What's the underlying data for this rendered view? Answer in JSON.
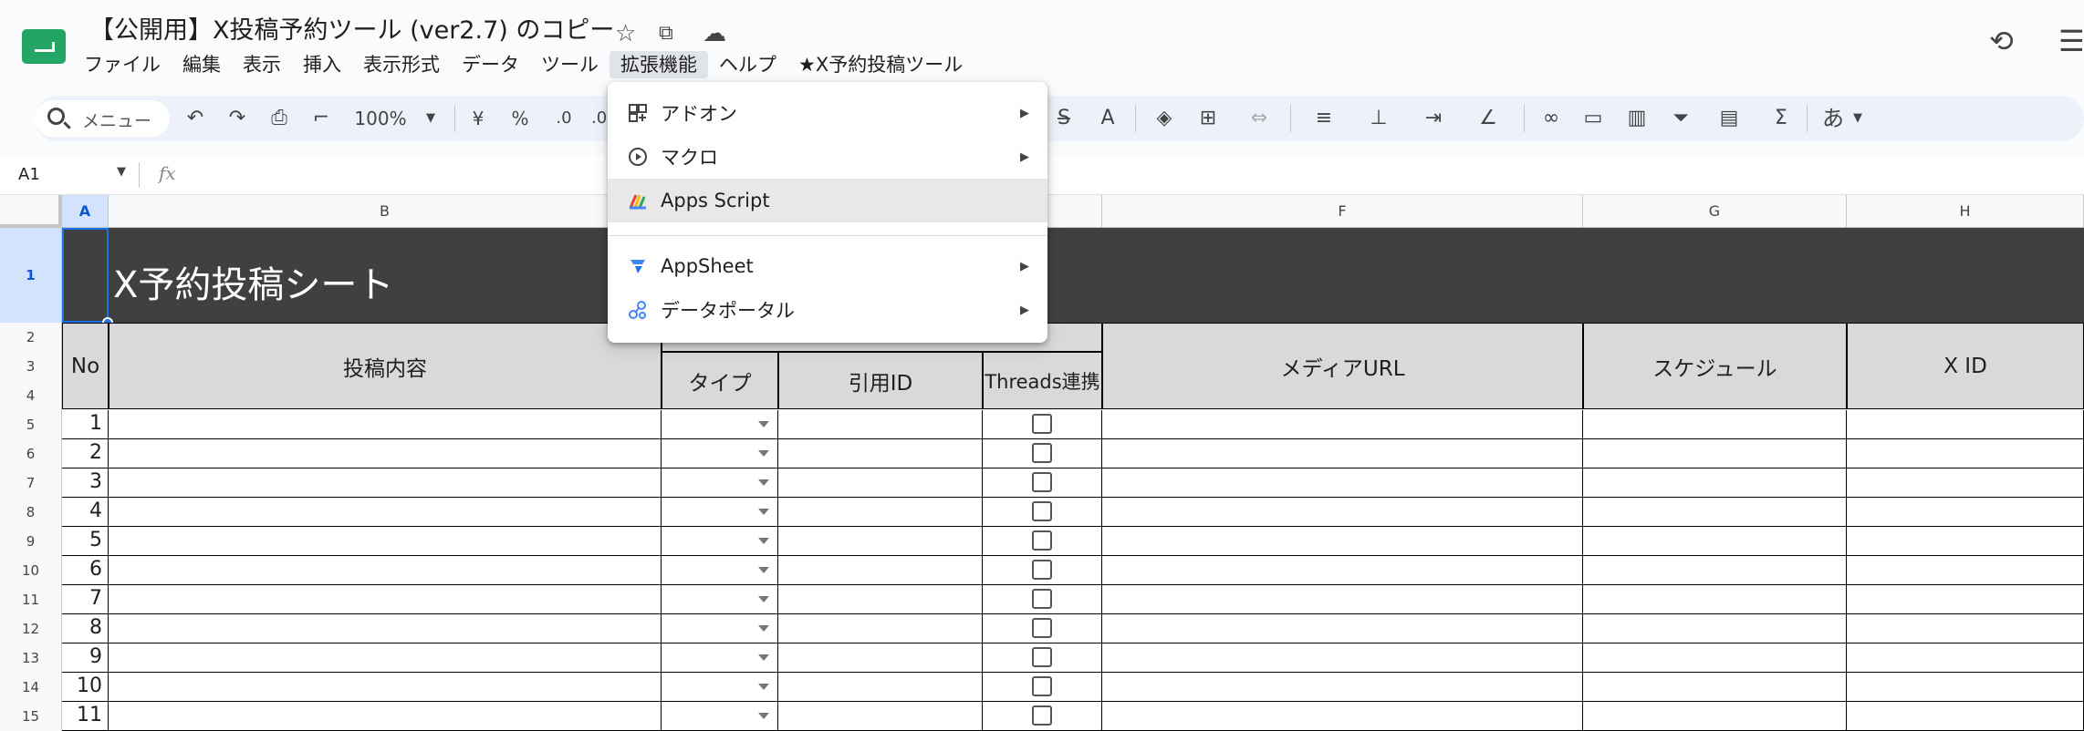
{
  "doc": {
    "title": "【公開用】X投稿予約ツール (ver2.7) のコピー"
  },
  "menus": [
    "ファイル",
    "編集",
    "表示",
    "挿入",
    "表示形式",
    "データ",
    "ツール",
    "拡張機能",
    "ヘルプ",
    "★X予約投稿ツール"
  ],
  "toolbar": {
    "search_placeholder": "メニュー",
    "zoom": "100%",
    "currency": "¥",
    "percent": "%",
    "dec_decrease": ".0",
    "dec_increase": ".0",
    "text_color": "A",
    "input_tools": "あ"
  },
  "formula_bar": {
    "cell_ref": "A1",
    "fx": "fx"
  },
  "columns": [
    "A",
    "B",
    "F",
    "G",
    "H"
  ],
  "rows": [
    "1",
    "2",
    "3",
    "4",
    "5",
    "6",
    "7",
    "8",
    "9",
    "10",
    "11",
    "12",
    "13",
    "14",
    "15"
  ],
  "sheet": {
    "banner": "X予約投稿シート",
    "headers": {
      "no": "No",
      "content": "投稿内容",
      "sub_type": "タイプ",
      "sub_quote": "引用ID",
      "sub_threads": "Threads連携",
      "media": "メディアURL",
      "schedule": "スケジュール",
      "xid": "X ID"
    },
    "numbers": [
      "1",
      "2",
      "3",
      "4",
      "5",
      "6",
      "7",
      "8",
      "9",
      "10",
      "11"
    ]
  },
  "ext_menu": {
    "addon": "アドオン",
    "macro": "マクロ",
    "apps_script": "Apps Script",
    "appsheet": "AppSheet",
    "data_portal": "データポータル"
  },
  "colors": {
    "accent": "#1a73e8",
    "sheets_green": "#22a565",
    "banner": "#404040",
    "header_gray": "#d9d9d9"
  }
}
